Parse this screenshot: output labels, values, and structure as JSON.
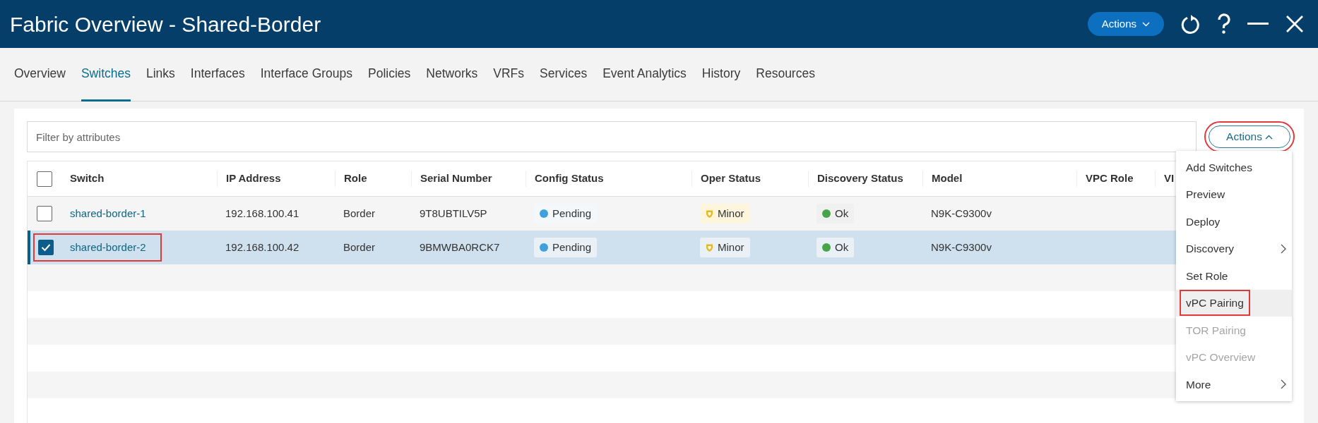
{
  "window": {
    "title": "Fabric Overview - Shared-Border",
    "actions_button": "Actions"
  },
  "tabs": [
    {
      "label": "Overview",
      "selected": false
    },
    {
      "label": "Switches",
      "selected": true
    },
    {
      "label": "Links",
      "selected": false
    },
    {
      "label": "Interfaces",
      "selected": false
    },
    {
      "label": "Interface Groups",
      "selected": false
    },
    {
      "label": "Policies",
      "selected": false
    },
    {
      "label": "Networks",
      "selected": false
    },
    {
      "label": "VRFs",
      "selected": false
    },
    {
      "label": "Services",
      "selected": false
    },
    {
      "label": "Event Analytics",
      "selected": false
    },
    {
      "label": "History",
      "selected": false
    },
    {
      "label": "Resources",
      "selected": false
    }
  ],
  "filter": {
    "placeholder": "Filter by attributes"
  },
  "actions_button": {
    "label": "Actions",
    "expanded": true,
    "highlighted": true
  },
  "table": {
    "select_all_checked": false,
    "columns": [
      "Switch",
      "IP Address",
      "Role",
      "Serial Number",
      "Config Status",
      "Oper Status",
      "Discovery Status",
      "Model",
      "VPC Role",
      "VI"
    ],
    "rows": [
      {
        "selected": false,
        "checked": false,
        "highlighted": false,
        "switch": "shared-border-1",
        "ip": "192.168.100.41",
        "role": "Border",
        "serial": "9T8UBTILV5P",
        "config_status": {
          "text": "Pending",
          "color": "#3fa0dc"
        },
        "oper_status": {
          "text": "Minor",
          "color": "#e8b820"
        },
        "discovery_status": {
          "text": "Ok",
          "color": "#47a447"
        },
        "model": "N9K-C9300v"
      },
      {
        "selected": true,
        "checked": true,
        "highlighted": true,
        "switch": "shared-border-2",
        "ip": "192.168.100.42",
        "role": "Border",
        "serial": "9BMWBA0RCK7",
        "config_status": {
          "text": "Pending",
          "color": "#3fa0dc"
        },
        "oper_status": {
          "text": "Minor",
          "color": "#e8b820"
        },
        "discovery_status": {
          "text": "Ok",
          "color": "#47a447"
        },
        "model": "N9K-C9300v"
      }
    ]
  },
  "actions_menu": [
    {
      "label": "Add Switches",
      "disabled": false,
      "submenu": false,
      "hovered": false,
      "highlighted": false
    },
    {
      "label": "Preview",
      "disabled": false,
      "submenu": false,
      "hovered": false,
      "highlighted": false
    },
    {
      "label": "Deploy",
      "disabled": false,
      "submenu": false,
      "hovered": false,
      "highlighted": false
    },
    {
      "label": "Discovery",
      "disabled": false,
      "submenu": true,
      "hovered": false,
      "highlighted": false
    },
    {
      "label": "Set Role",
      "disabled": false,
      "submenu": false,
      "hovered": false,
      "highlighted": false
    },
    {
      "label": "vPC Pairing",
      "disabled": false,
      "submenu": false,
      "hovered": true,
      "highlighted": true
    },
    {
      "label": "TOR Pairing",
      "disabled": true,
      "submenu": false,
      "hovered": false,
      "highlighted": false
    },
    {
      "label": "vPC Overview",
      "disabled": true,
      "submenu": false,
      "hovered": false,
      "highlighted": false
    },
    {
      "label": "More",
      "disabled": false,
      "submenu": true,
      "hovered": false,
      "highlighted": false
    }
  ]
}
